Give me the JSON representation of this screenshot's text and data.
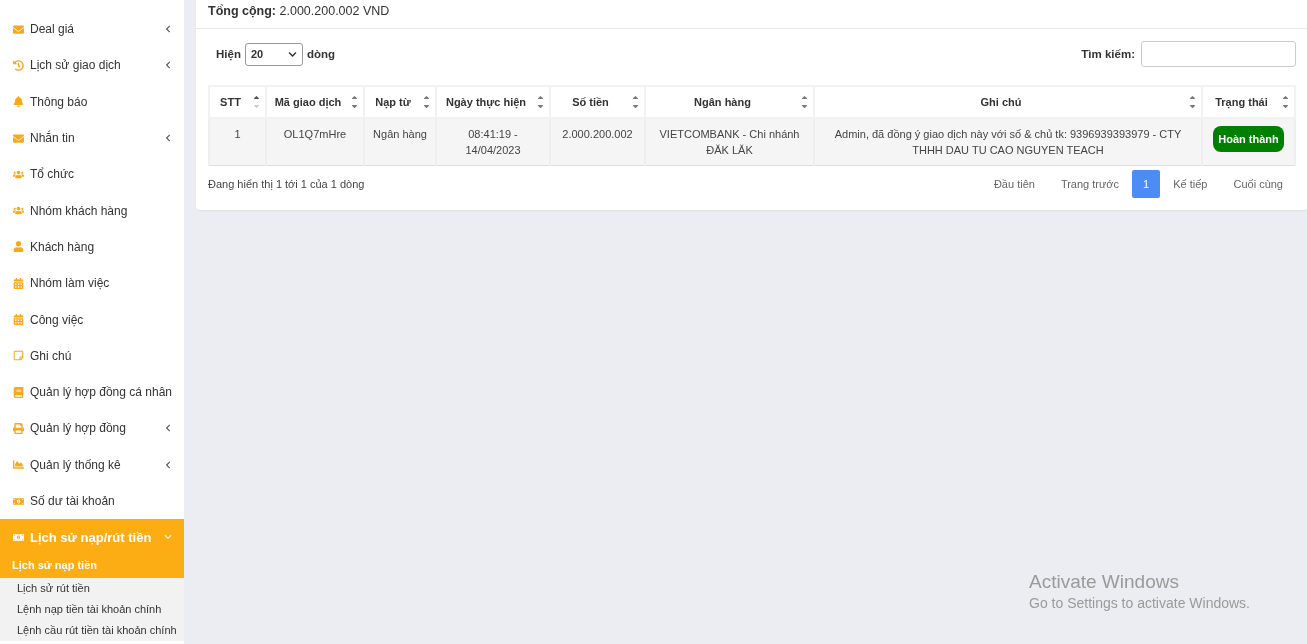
{
  "sidebar": {
    "items": [
      {
        "label": "Deal giá",
        "expanded": false,
        "selected": false
      },
      {
        "label": "Lịch sử giao dịch",
        "expanded": false,
        "selected": false
      },
      {
        "label": "Thông báo",
        "selected": false
      },
      {
        "label": "Nhắn tin",
        "expanded": false,
        "selected": false
      },
      {
        "label": "Tổ chức",
        "selected": false
      },
      {
        "label": "Nhóm khách hàng",
        "selected": false
      },
      {
        "label": "Khách hàng",
        "selected": false
      },
      {
        "label": "Nhóm làm việc",
        "selected": false
      },
      {
        "label": "Công việc",
        "selected": false
      },
      {
        "label": "Ghi chú",
        "selected": false
      },
      {
        "label": "Quản lý hợp đồng cá nhân",
        "selected": false
      },
      {
        "label": "Quản lý hợp đồng",
        "expanded": false,
        "selected": false
      },
      {
        "label": "Quản lý thống kê",
        "expanded": false,
        "selected": false
      },
      {
        "label": "Số dư tài khoản",
        "selected": false
      },
      {
        "label": "Lịch sử nạp/rút tiền",
        "expanded": true,
        "selected": true,
        "children": [
          {
            "label": "Lịch sử nạp tiền",
            "selected": true
          },
          {
            "label": "Lịch sử rút tiền",
            "selected": false
          },
          {
            "label": "Lệnh nạp tiền tài khoản chính",
            "selected": false
          },
          {
            "label": "Lệnh cầu rút tiền tài khoản chính",
            "selected": false
          }
        ]
      }
    ]
  },
  "total": {
    "label": "Tổng cộng:",
    "value": "2.000.200.002 VND"
  },
  "page_size": {
    "prefix": "Hiện",
    "value": "20",
    "suffix": "dòng"
  },
  "search": {
    "label": "Tìm kiếm:"
  },
  "table": {
    "columns": [
      {
        "label": "STT",
        "sorted": true
      },
      {
        "label": "Mã giao dịch",
        "sorted": false
      },
      {
        "label": "Nạp từ",
        "sorted": false
      },
      {
        "label": "Ngày thực hiện",
        "sorted": false
      },
      {
        "label": "Số tiền",
        "sorted": false
      },
      {
        "label": "Ngân hàng",
        "sorted": false
      },
      {
        "label": "Ghi chú",
        "sorted": false
      },
      {
        "label": "Trạng thái",
        "sorted": false
      }
    ],
    "rows": [
      {
        "cells": [
          "1",
          "OL1Q7mHre",
          "Ngân hàng",
          "08:41:19 - 14/04/2023",
          "2.000.200.002",
          "VIETCOMBANK - Chi nhánh ĐĂK LĂK",
          "Admin, đã đồng ý giao dịch này với số & chủ tk: 9396939393979 - CTY THHH DAU TU CAO NGUYEN TEACH"
        ],
        "status": "Hoàn thành",
        "completed": true
      }
    ]
  },
  "info": "Đang hiển thị 1 tới 1 của 1 dòng",
  "pagination": [
    {
      "label": "Đầu tiên",
      "selected": false
    },
    {
      "label": "Trang trước",
      "selected": false
    },
    {
      "label": "1",
      "selected": true
    },
    {
      "label": "Kế tiếp",
      "selected": false
    },
    {
      "label": "Cuối cùng",
      "selected": false
    }
  ],
  "os_notice": {
    "title": "Activate Windows",
    "subtitle": "Go to Settings to activate Windows."
  }
}
